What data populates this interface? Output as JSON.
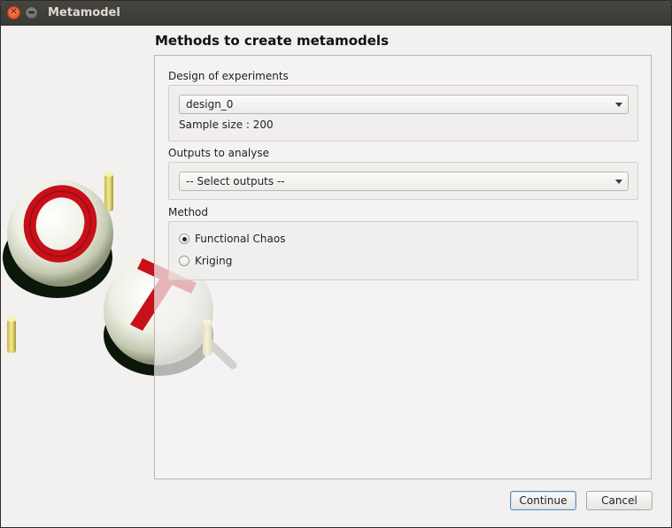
{
  "window": {
    "title": "Metamodel"
  },
  "page": {
    "heading": "Methods to create metamodels"
  },
  "design_section": {
    "label": "Design of experiments",
    "selected": "design_0",
    "sample_size_text": "Sample size : 200"
  },
  "outputs_section": {
    "label": "Outputs to analyse",
    "selected": "-- Select outputs --"
  },
  "method_section": {
    "label": "Method",
    "options": [
      {
        "label": "Functional Chaos",
        "checked": true
      },
      {
        "label": "Kriging",
        "checked": false
      }
    ]
  },
  "buttons": {
    "continue_label": "Continue",
    "cancel_label": "Cancel"
  },
  "logo": {
    "letters": [
      "O",
      "T"
    ]
  },
  "colors": {
    "accent_red": "#c8101a",
    "focus_blue": "#5f8bbd",
    "titlebar": "#3c3b37"
  }
}
